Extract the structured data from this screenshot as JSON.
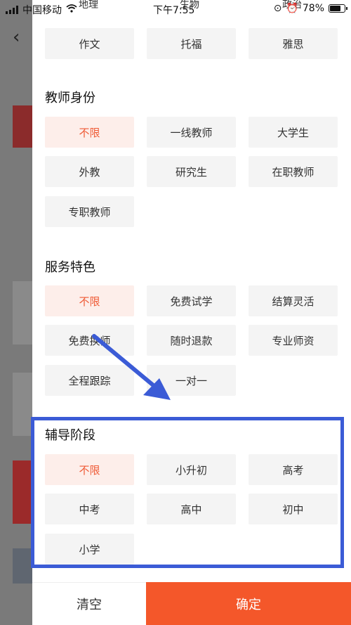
{
  "status_bar": {
    "carrier": "中国移动",
    "time": "下午7:55",
    "battery": "78%"
  },
  "background": {
    "back_icon": "chevron-left-icon"
  },
  "top_partial": [
    "地理",
    "生物",
    "政治"
  ],
  "subjects_row": [
    "作文",
    "托福",
    "雅思"
  ],
  "teacher_identity": {
    "title": "教师身份",
    "options": [
      "不限",
      "一线教师",
      "大学生",
      "外教",
      "研究生",
      "在职教师",
      "专职教师"
    ]
  },
  "service_features": {
    "title": "服务特色",
    "options": [
      "不限",
      "免费试学",
      "结算灵活",
      "免费换师",
      "随时退款",
      "专业师资",
      "全程跟踪",
      "一对一"
    ]
  },
  "tutoring_stage": {
    "title": "辅导阶段",
    "options": [
      "不限",
      "小升初",
      "高考",
      "中考",
      "高中",
      "初中",
      "小学"
    ]
  },
  "actions": {
    "clear": "清空",
    "confirm": "确定"
  },
  "colors": {
    "accent": "#f4572a",
    "active_chip_text": "#ef5a35",
    "annotation": "#3b5bd6"
  }
}
